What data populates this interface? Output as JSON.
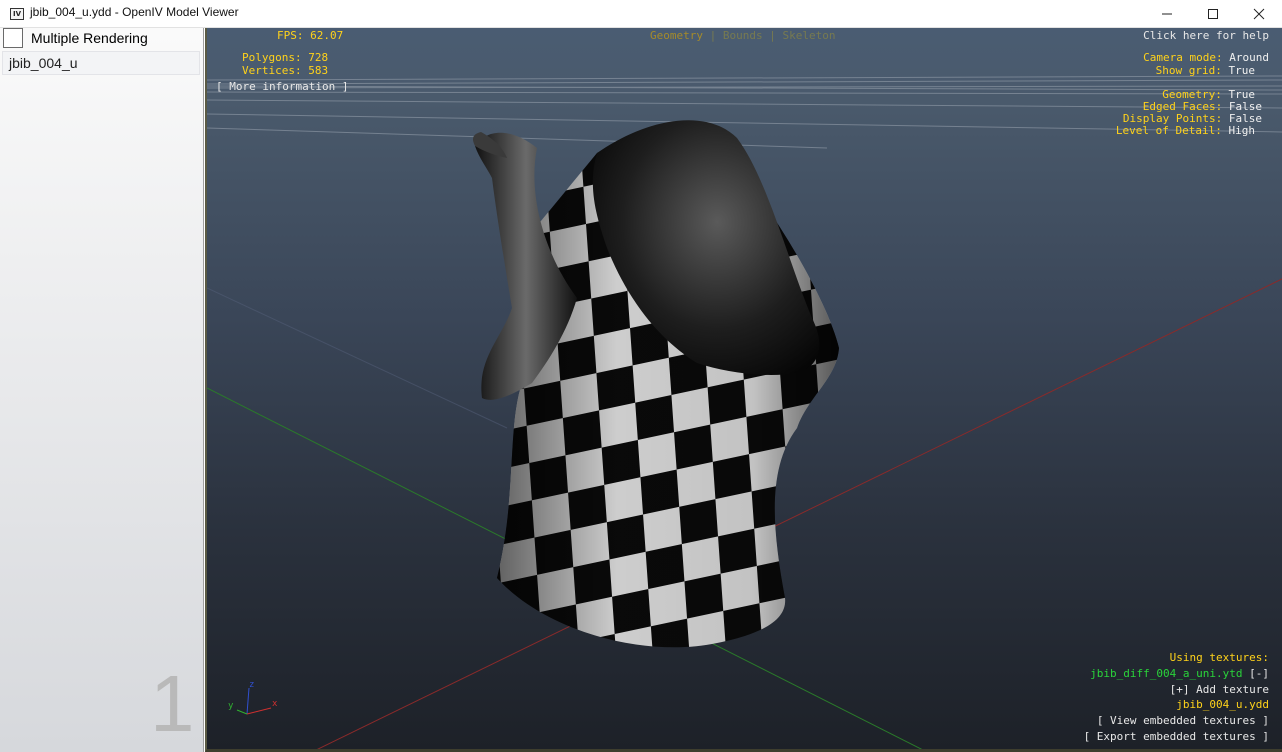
{
  "window": {
    "title": "jbib_004_u.ydd - OpenIV Model Viewer",
    "icon_text": "IV",
    "minimize_icon": "minimize-icon",
    "maximize_icon": "maximize-icon",
    "close_icon": "close-icon"
  },
  "sidebar": {
    "multiple_rendering_label": "Multiple Rendering",
    "multiple_rendering_checked": false,
    "models": [
      "jbib_004_u"
    ],
    "page_indicator": "1"
  },
  "viewport": {
    "tabs": [
      {
        "label": "Geometry",
        "active": true
      },
      {
        "label": "Bounds",
        "active": false
      },
      {
        "label": "Skeleton",
        "active": false
      }
    ],
    "tab_separator": "|",
    "stats": {
      "fps_label": "FPS:",
      "fps_value": "62.07",
      "polygons_label": "Polygons:",
      "polygons_value": "728",
      "vertices_label": "Vertices:",
      "vertices_value": "583"
    },
    "more_info": "[ More information ]",
    "help": "Click here for help",
    "camera": {
      "label": "Camera mode:",
      "value": "Around"
    },
    "grid": {
      "label": "Show grid:",
      "value": "True"
    },
    "render_options": [
      {
        "label": "Geometry:",
        "value": "True"
      },
      {
        "label": "Edged Faces:",
        "value": "False"
      },
      {
        "label": "Display Points:",
        "value": "False"
      },
      {
        "label": "Level of Detail:",
        "value": "High"
      }
    ],
    "textures": {
      "heading": "Using textures:",
      "texture_file": "jbib_diff_004_a_uni.ytd",
      "remove": "[-]",
      "add": "[+] Add texture",
      "model_file": "jbib_004_u.ydd",
      "view_embedded": "[ View embedded textures ]",
      "export_embedded": "[ Export embedded textures ]"
    },
    "axis_labels": {
      "x": "x",
      "y": "y",
      "z": "z"
    },
    "colors": {
      "hud_yellow": "#ffd21a",
      "texture_green": "#2ad43a",
      "axis_x": "#d03030",
      "axis_y": "#30b030",
      "axis_z": "#3050d0"
    }
  }
}
